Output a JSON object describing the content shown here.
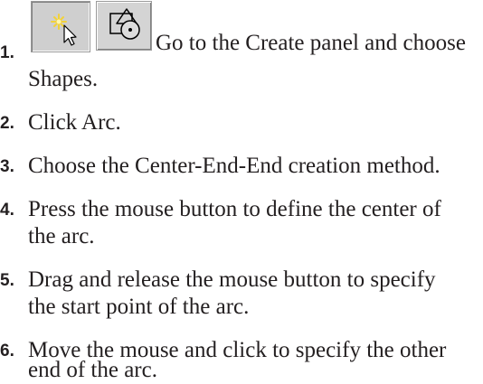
{
  "toolbar": {
    "create_icon": "create-panel-icon",
    "shapes_icon": "shapes-icon"
  },
  "steps": [
    {
      "number": "1.",
      "lines": [
        "Go to the Create panel and choose",
        "Shapes."
      ]
    },
    {
      "number": "2.",
      "lines": [
        "Click Arc."
      ]
    },
    {
      "number": "3.",
      "lines": [
        "Choose the Center-End-End creation method."
      ]
    },
    {
      "number": "4.",
      "lines": [
        "Press the mouse button to define the center of",
        "the arc."
      ]
    },
    {
      "number": "5.",
      "lines": [
        "Drag and release the mouse button to specify",
        "the start point of the arc."
      ]
    },
    {
      "number": "6.",
      "lines": [
        "Move the mouse and click to specify the other",
        "end of the arc."
      ]
    }
  ]
}
